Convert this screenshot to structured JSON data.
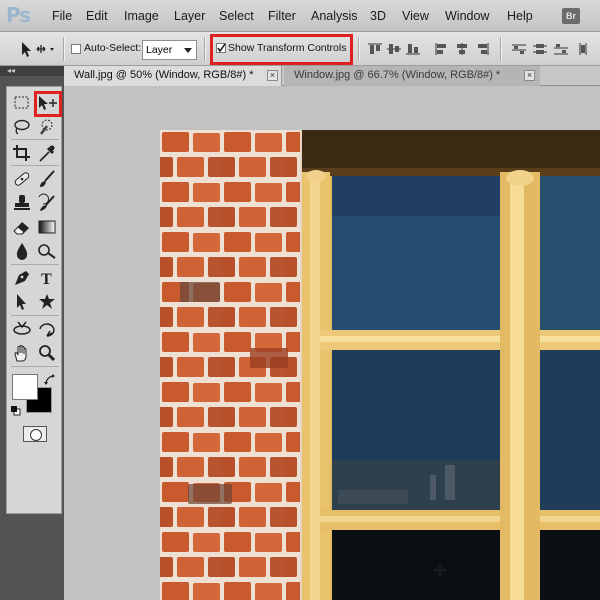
{
  "app": {
    "logo": "Ps"
  },
  "menu": {
    "items": [
      "File",
      "Edit",
      "Image",
      "Layer",
      "Select",
      "Filter",
      "Analysis",
      "3D",
      "View",
      "Window",
      "Help"
    ],
    "bridge_button": "Br"
  },
  "options": {
    "auto_select_label": "Auto-Select:",
    "auto_select_checked": false,
    "auto_select_target": "Layer",
    "show_transform_label": "Show Transform Controls",
    "show_transform_checked": true
  },
  "tabs": [
    {
      "label": "Wall.jpg @ 50% (Window, RGB/8#) *",
      "active": true,
      "close": "×"
    },
    {
      "label": "Window.jpg @ 66.7% (Window, RGB/8#) *",
      "active": false,
      "close": "×"
    }
  ],
  "tools": {
    "selected": "move-tool",
    "list": [
      "rectangular-marquee-tool",
      "move-tool",
      "lasso-tool",
      "quick-selection-tool",
      "crop-tool",
      "eyedropper-tool",
      "spot-healing-brush-tool",
      "brush-tool",
      "clone-stamp-tool",
      "history-brush-tool",
      "eraser-tool",
      "gradient-tool",
      "blur-tool",
      "dodge-tool",
      "pen-tool",
      "type-tool",
      "path-selection-tool",
      "custom-shape-tool",
      "3d-rotate-tool",
      "3d-orbit-tool",
      "hand-tool",
      "zoom-tool"
    ],
    "type_glyph": "T"
  },
  "colors": {
    "foreground": "#ffffff",
    "background": "#000000",
    "highlight": "#e02020"
  }
}
